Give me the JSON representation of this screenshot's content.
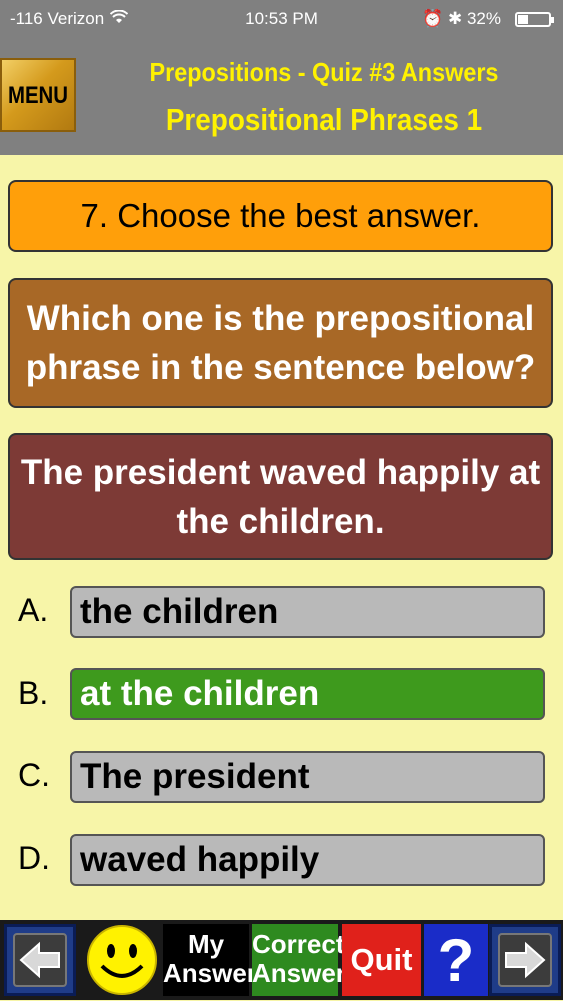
{
  "status_bar": {
    "carrier": "-116 Verizon",
    "time": "10:53 PM",
    "battery": "32%",
    "battery_level": 0.32
  },
  "header": {
    "menu_label": "MENU",
    "title": "Prepositions - Quiz #3 Answers",
    "subtitle": "Prepositional Phrases 1"
  },
  "quiz": {
    "instruction": "7. Choose the best answer.",
    "question": "Which one is the prepositional phrase in the sentence below?",
    "sentence": "The president waved happily at the children.",
    "options": [
      {
        "letter": "A.",
        "text": "the children"
      },
      {
        "letter": "B.",
        "text": "at the children"
      },
      {
        "letter": "C.",
        "text": "The president"
      },
      {
        "letter": "D.",
        "text": "waved happily"
      }
    ],
    "correct_index": 1
  },
  "toolbar": {
    "back_icon": "left-arrow-icon",
    "feedback_icon": "smiley-face-icon",
    "my_answer_line1": "My",
    "my_answer_line2": "Answer",
    "correct_answer_line1": "Correct",
    "correct_answer_line2": "Answer",
    "quit_label": "Quit",
    "help_label": "?",
    "forward_icon": "right-arrow-icon"
  }
}
